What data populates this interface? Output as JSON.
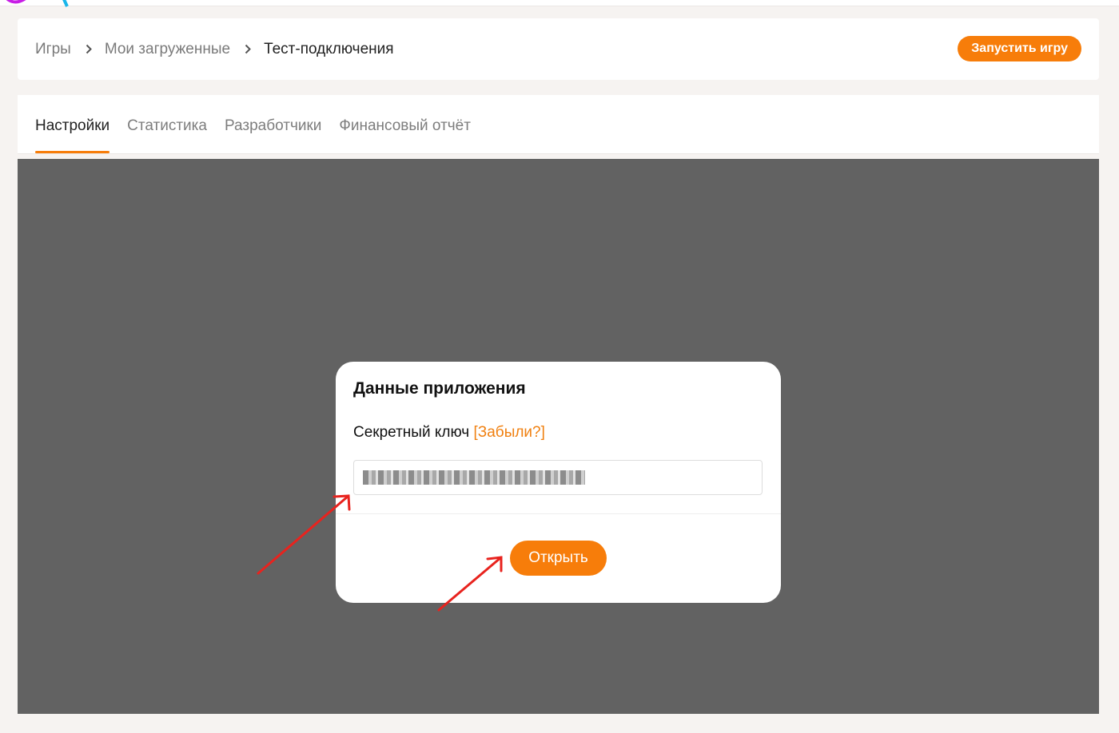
{
  "breadcrumb": {
    "items": [
      "Игры",
      "Мои загруженные",
      "Тест-подключения"
    ]
  },
  "header": {
    "run_button": "Запустить игру"
  },
  "tabs": [
    {
      "label": "Настройки",
      "active": true
    },
    {
      "label": "Статистика",
      "active": false
    },
    {
      "label": "Разработчики",
      "active": false
    },
    {
      "label": "Финансовый отчёт",
      "active": false
    }
  ],
  "modal": {
    "title": "Данные приложения",
    "secret_label": "Секретный ключ",
    "forgot_link": "[Забыли?]",
    "secret_value_state": "blurred",
    "open_button": "Открыть"
  },
  "annotations": {
    "arrow_color": "#e8231e",
    "targets": [
      "secret-key-input",
      "open-button"
    ]
  },
  "colors": {
    "accent": "#f77d0a",
    "overlay": "#626262",
    "page_background": "#f6f3f1"
  }
}
